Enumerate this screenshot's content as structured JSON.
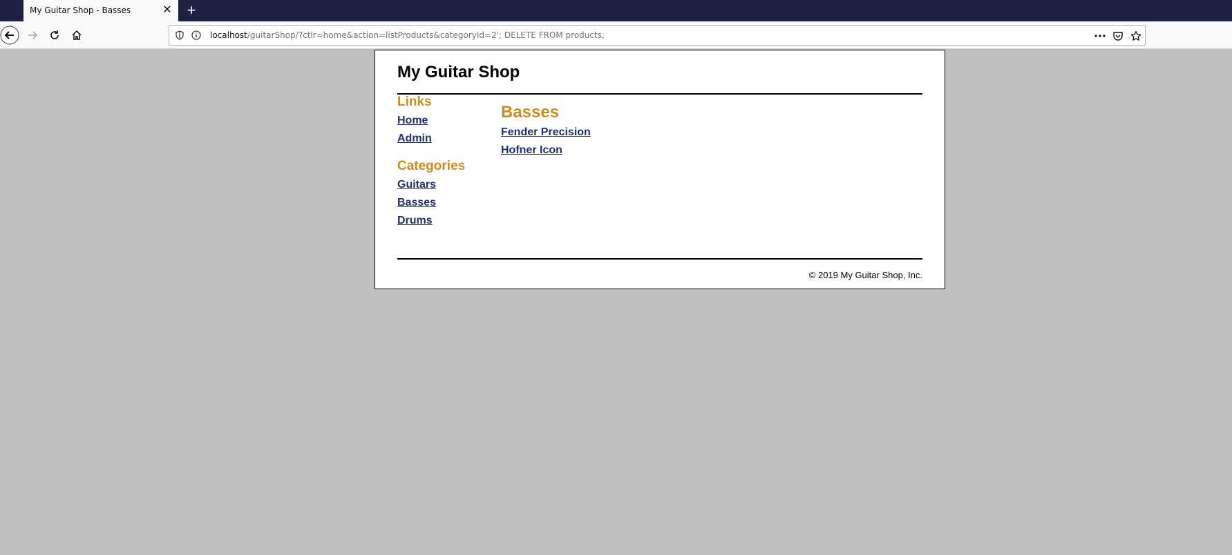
{
  "browser": {
    "tab_title": "My Guitar Shop - Basses",
    "url_host": "localhost",
    "url_rest": "/guitarShop/?ctlr=home&action=listProducts&categoryId=2'; DELETE FROM products;"
  },
  "site": {
    "title": "My Guitar Shop",
    "footer": "© 2019 My Guitar Shop, Inc."
  },
  "sidebar": {
    "links_heading": "Links",
    "links": [
      "Home",
      "Admin"
    ],
    "categories_heading": "Categories",
    "categories": [
      "Guitars",
      "Basses",
      "Drums"
    ]
  },
  "main": {
    "heading": "Basses",
    "products": [
      "Fender Precision",
      "Hofner Icon"
    ]
  },
  "colors": {
    "heading_accent": "#d08a1e",
    "link": "#21306b",
    "background": "#c0c0c0",
    "tabbar": "#1f2143"
  }
}
